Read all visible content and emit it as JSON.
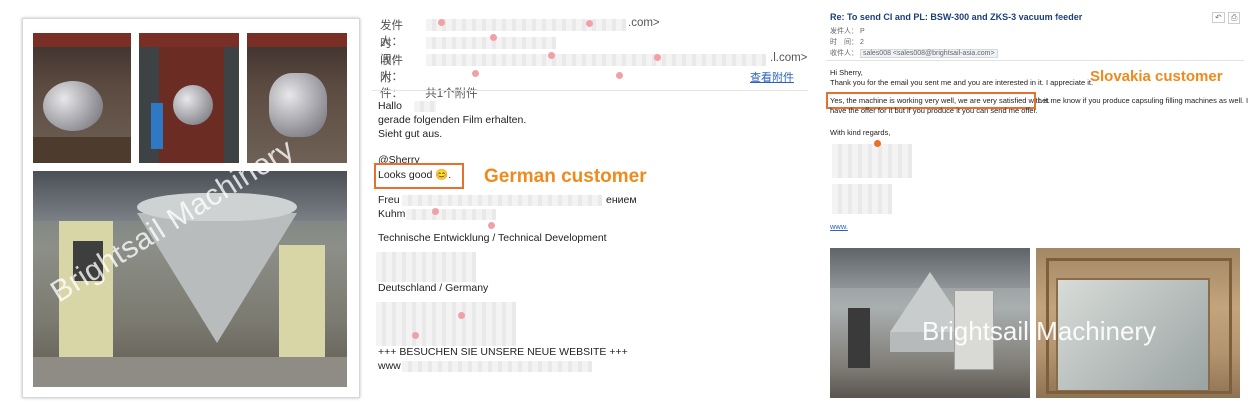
{
  "watermark": "Brightsail Machinery",
  "german_email": {
    "header": {
      "from_label": "发件人：",
      "from_value": ".com>",
      "time_label": "时　间：",
      "to_label": "收件人：",
      "to_value": ".l.com>",
      "attach_label": "附　件：",
      "attach_value": "共1个附件",
      "view_attachment": "查看附件"
    },
    "body": {
      "greeting": "Hallo",
      "line1": "gerade folgenden Film erhalten.",
      "line2": "Sieht gut aus.",
      "mention": "@Sherry",
      "highlight": "Looks good 😊.",
      "signoff_partial": "Freu",
      "signoff_end": "ением",
      "name_partial": "Kuhm",
      "department": "Technische Entwicklung / Technical Development",
      "country": "Deutschland / Germany",
      "website_line": "+++ BESUCHEN SIE UNSERE NEUE WEBSITE +++",
      "website_url_partial": "www"
    },
    "callout": "German customer"
  },
  "slovakia_email": {
    "subject": "Re: To send CI and PL: BSW-300 and ZKS-3 vacuum feeder",
    "header": {
      "from_label": "发件人：",
      "from_value": "P",
      "time_label": "时　间：",
      "time_value": "2",
      "to_label": "收件人：",
      "to_value": "sales008 <sales008@brightsail-asia.com>"
    },
    "body": {
      "greeting": "Hi Sherry,",
      "line1": "Thank you for the email you sent me and you are interested in it. I appreciate it.",
      "highlight": "Yes, the machine is working very well, we are very satisfied with it.",
      "line2_rest": "Let me know if you produce capsuling filling machines as well. I",
      "line3": "have the offer for it but if you produce it you can send me offer.",
      "regards": "With kind regards,",
      "website_partial": "www."
    },
    "callout": "Slovakia customer"
  },
  "colors": {
    "callout": "#f08a1c",
    "highlight_box": "#e8702f",
    "link": "#2b63b7"
  }
}
